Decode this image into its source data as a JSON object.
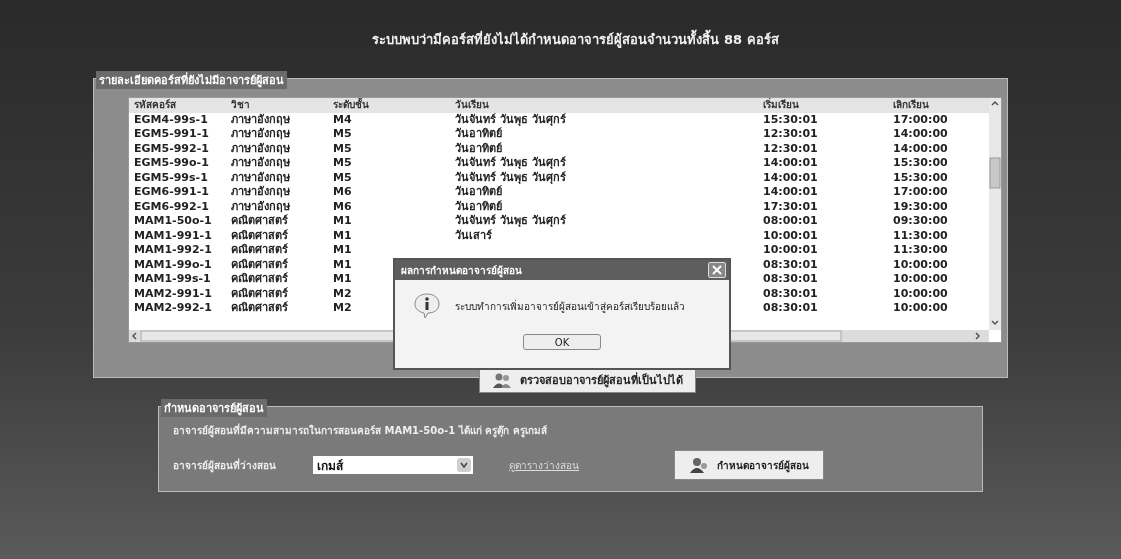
{
  "header": {
    "title": "ระบบพบว่ามีคอร์สที่ยังไม่ได้กำหนดอาจารย์ผู้สอนจำนวนทั้งสิ้น 88 คอร์ส"
  },
  "courses_group": {
    "title": "รายละเอียดคอร์สที่ยังไม่มีอาจารย์ผู้สอน",
    "table": {
      "columns": [
        "รหัสคอร์ส",
        "วิชา",
        "ระดับชั้น",
        "วันเรียน",
        "เริ่มเรียน",
        "เลิกเรียน"
      ],
      "rows": [
        {
          "code": "EGM4-99s-1",
          "subject": "ภาษาอังกฤษ",
          "level": "M4",
          "days": "วันจันทร์ วันพุธ วันศุกร์",
          "start": "15:30:01",
          "end": "17:00:00"
        },
        {
          "code": "EGM5-991-1",
          "subject": "ภาษาอังกฤษ",
          "level": "M5",
          "days": "วันอาทิตย์",
          "start": "12:30:01",
          "end": "14:00:00"
        },
        {
          "code": "EGM5-992-1",
          "subject": "ภาษาอังกฤษ",
          "level": "M5",
          "days": "วันอาทิตย์",
          "start": "12:30:01",
          "end": "14:00:00"
        },
        {
          "code": "EGM5-99o-1",
          "subject": "ภาษาอังกฤษ",
          "level": "M5",
          "days": "วันจันทร์ วันพุธ วันศุกร์",
          "start": "14:00:01",
          "end": "15:30:00"
        },
        {
          "code": "EGM5-99s-1",
          "subject": "ภาษาอังกฤษ",
          "level": "M5",
          "days": "วันจันทร์ วันพุธ วันศุกร์",
          "start": "14:00:01",
          "end": "15:30:00"
        },
        {
          "code": "EGM6-991-1",
          "subject": "ภาษาอังกฤษ",
          "level": "M6",
          "days": "วันอาทิตย์",
          "start": "14:00:01",
          "end": "17:00:00"
        },
        {
          "code": "EGM6-992-1",
          "subject": "ภาษาอังกฤษ",
          "level": "M6",
          "days": "วันอาทิตย์",
          "start": "17:30:01",
          "end": "19:30:00"
        },
        {
          "code": "MAM1-50o-1",
          "subject": "คณิตศาสตร์",
          "level": "M1",
          "days": "วันจันทร์ วันพุธ วันศุกร์",
          "start": "08:00:01",
          "end": "09:30:00"
        },
        {
          "code": "MAM1-991-1",
          "subject": "คณิตศาสตร์",
          "level": "M1",
          "days": "วันเสาร์",
          "start": "10:00:01",
          "end": "11:30:00"
        },
        {
          "code": "MAM1-992-1",
          "subject": "คณิตศาสตร์",
          "level": "M1",
          "start": "10:00:01",
          "end": "11:30:00"
        },
        {
          "code": "MAM1-99o-1",
          "subject": "คณิตศาสตร์",
          "level": "M1",
          "start": "08:30:01",
          "end": "10:00:00"
        },
        {
          "code": "MAM1-99s-1",
          "subject": "คณิตศาสตร์",
          "level": "M1",
          "start": "08:30:01",
          "end": "10:00:00"
        },
        {
          "code": "MAM2-991-1",
          "subject": "คณิตศาสตร์",
          "level": "M2",
          "start": "08:30:01",
          "end": "10:00:00"
        },
        {
          "code": "MAM2-992-1",
          "subject": "คณิตศาสตร์",
          "level": "M2",
          "start": "08:30:01",
          "end": "10:00:00"
        }
      ]
    },
    "check_button": "ตรวจสอบอาจารย์ผู้สอนที่เป็นไปได้"
  },
  "dialog": {
    "title": "ผลการกำหนดอาจารย์ผู้สอน",
    "message": "ระบบทำการเพิ่มอาจารย์ผู้สอนเข้าสู่คอร์สเรียบร้อยแล้ว",
    "button": "OK"
  },
  "assign_group": {
    "title": "กำหนดอาจารย์ผู้สอน",
    "info": "อาจารย์ผู้สอนที่มีความสามารถในการสอนคอร์ส MAM1-50o-1 ได้แก่ ครูตุ๊ก ครูเกมส์",
    "teacher_label": "อาจารย์ผู้สอนที่ว่างสอน",
    "teacher_value": "เกมส์",
    "schedule_link": "ดูตารางว่างสอน",
    "assign_button": "กำหนดอาจารย์ผู้สอน"
  }
}
